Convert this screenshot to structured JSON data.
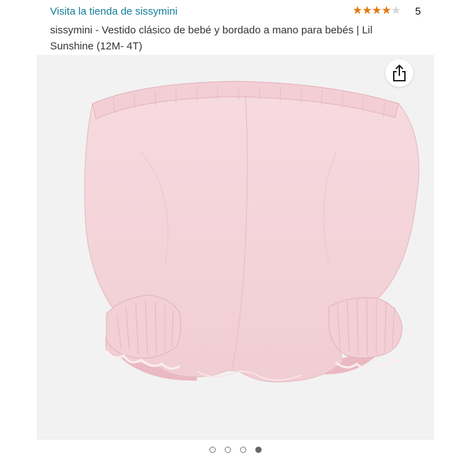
{
  "header": {
    "store_link": "Visita la tienda de sissymini",
    "rating": {
      "value": 3.5,
      "max": 5,
      "count": "5"
    }
  },
  "product": {
    "title": "sissymini - Vestido clásico de bebé y bordado a mano para bebés | Lil Sunshine (12M- 4T)"
  },
  "gallery": {
    "image": "pink-baby-bloomers-photo",
    "share_icon": "share-icon",
    "total": 4,
    "active_index": 3
  },
  "colors": {
    "link": "#127d9b",
    "star_fill": "#e47911",
    "star_empty": "#d5d5d5",
    "fabric_pink": "#f4d4d9"
  }
}
